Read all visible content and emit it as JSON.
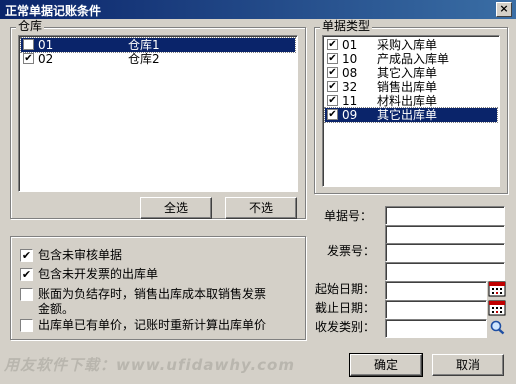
{
  "window": {
    "title": "正常单据记账条件",
    "close": "×"
  },
  "warehouse": {
    "label": "仓库",
    "items": [
      {
        "checked": false,
        "code": "01",
        "name": "仓库1",
        "selected": true
      },
      {
        "checked": true,
        "code": "02",
        "name": "仓库2",
        "selected": false
      }
    ],
    "select_all": "全选",
    "select_none": "不选"
  },
  "doc_types": {
    "label": "单据类型",
    "items": [
      {
        "checked": true,
        "code": "01",
        "name": "采购入库单",
        "selected": false
      },
      {
        "checked": true,
        "code": "10",
        "name": "产成品入库单",
        "selected": false
      },
      {
        "checked": true,
        "code": "08",
        "name": "其它入库单",
        "selected": false
      },
      {
        "checked": true,
        "code": "32",
        "name": "销售出库单",
        "selected": false
      },
      {
        "checked": true,
        "code": "11",
        "name": "材料出库单",
        "selected": false
      },
      {
        "checked": true,
        "code": "09",
        "name": "其它出库单",
        "selected": true
      }
    ]
  },
  "options": [
    {
      "checked": true,
      "label_lines": [
        "包含未审核单据"
      ]
    },
    {
      "checked": true,
      "label_lines": [
        "包含未开发票的出库单"
      ]
    },
    {
      "checked": false,
      "label_lines": [
        "账面为负结存时，销售出库成本取销售发票",
        "金额。"
      ]
    },
    {
      "checked": false,
      "label_lines": [
        "出库单已有单价，记账时重新计算出库单价"
      ]
    }
  ],
  "fields": {
    "doc_no": "单据号：",
    "invoice_no": "发票号：",
    "start_date": "起始日期：",
    "end_date": "截止日期：",
    "dispatch_type": "收发类别："
  },
  "buttons": {
    "ok": "确定",
    "cancel": "取消"
  },
  "watermark": "用友软件下载：www.ufidawhy.com"
}
